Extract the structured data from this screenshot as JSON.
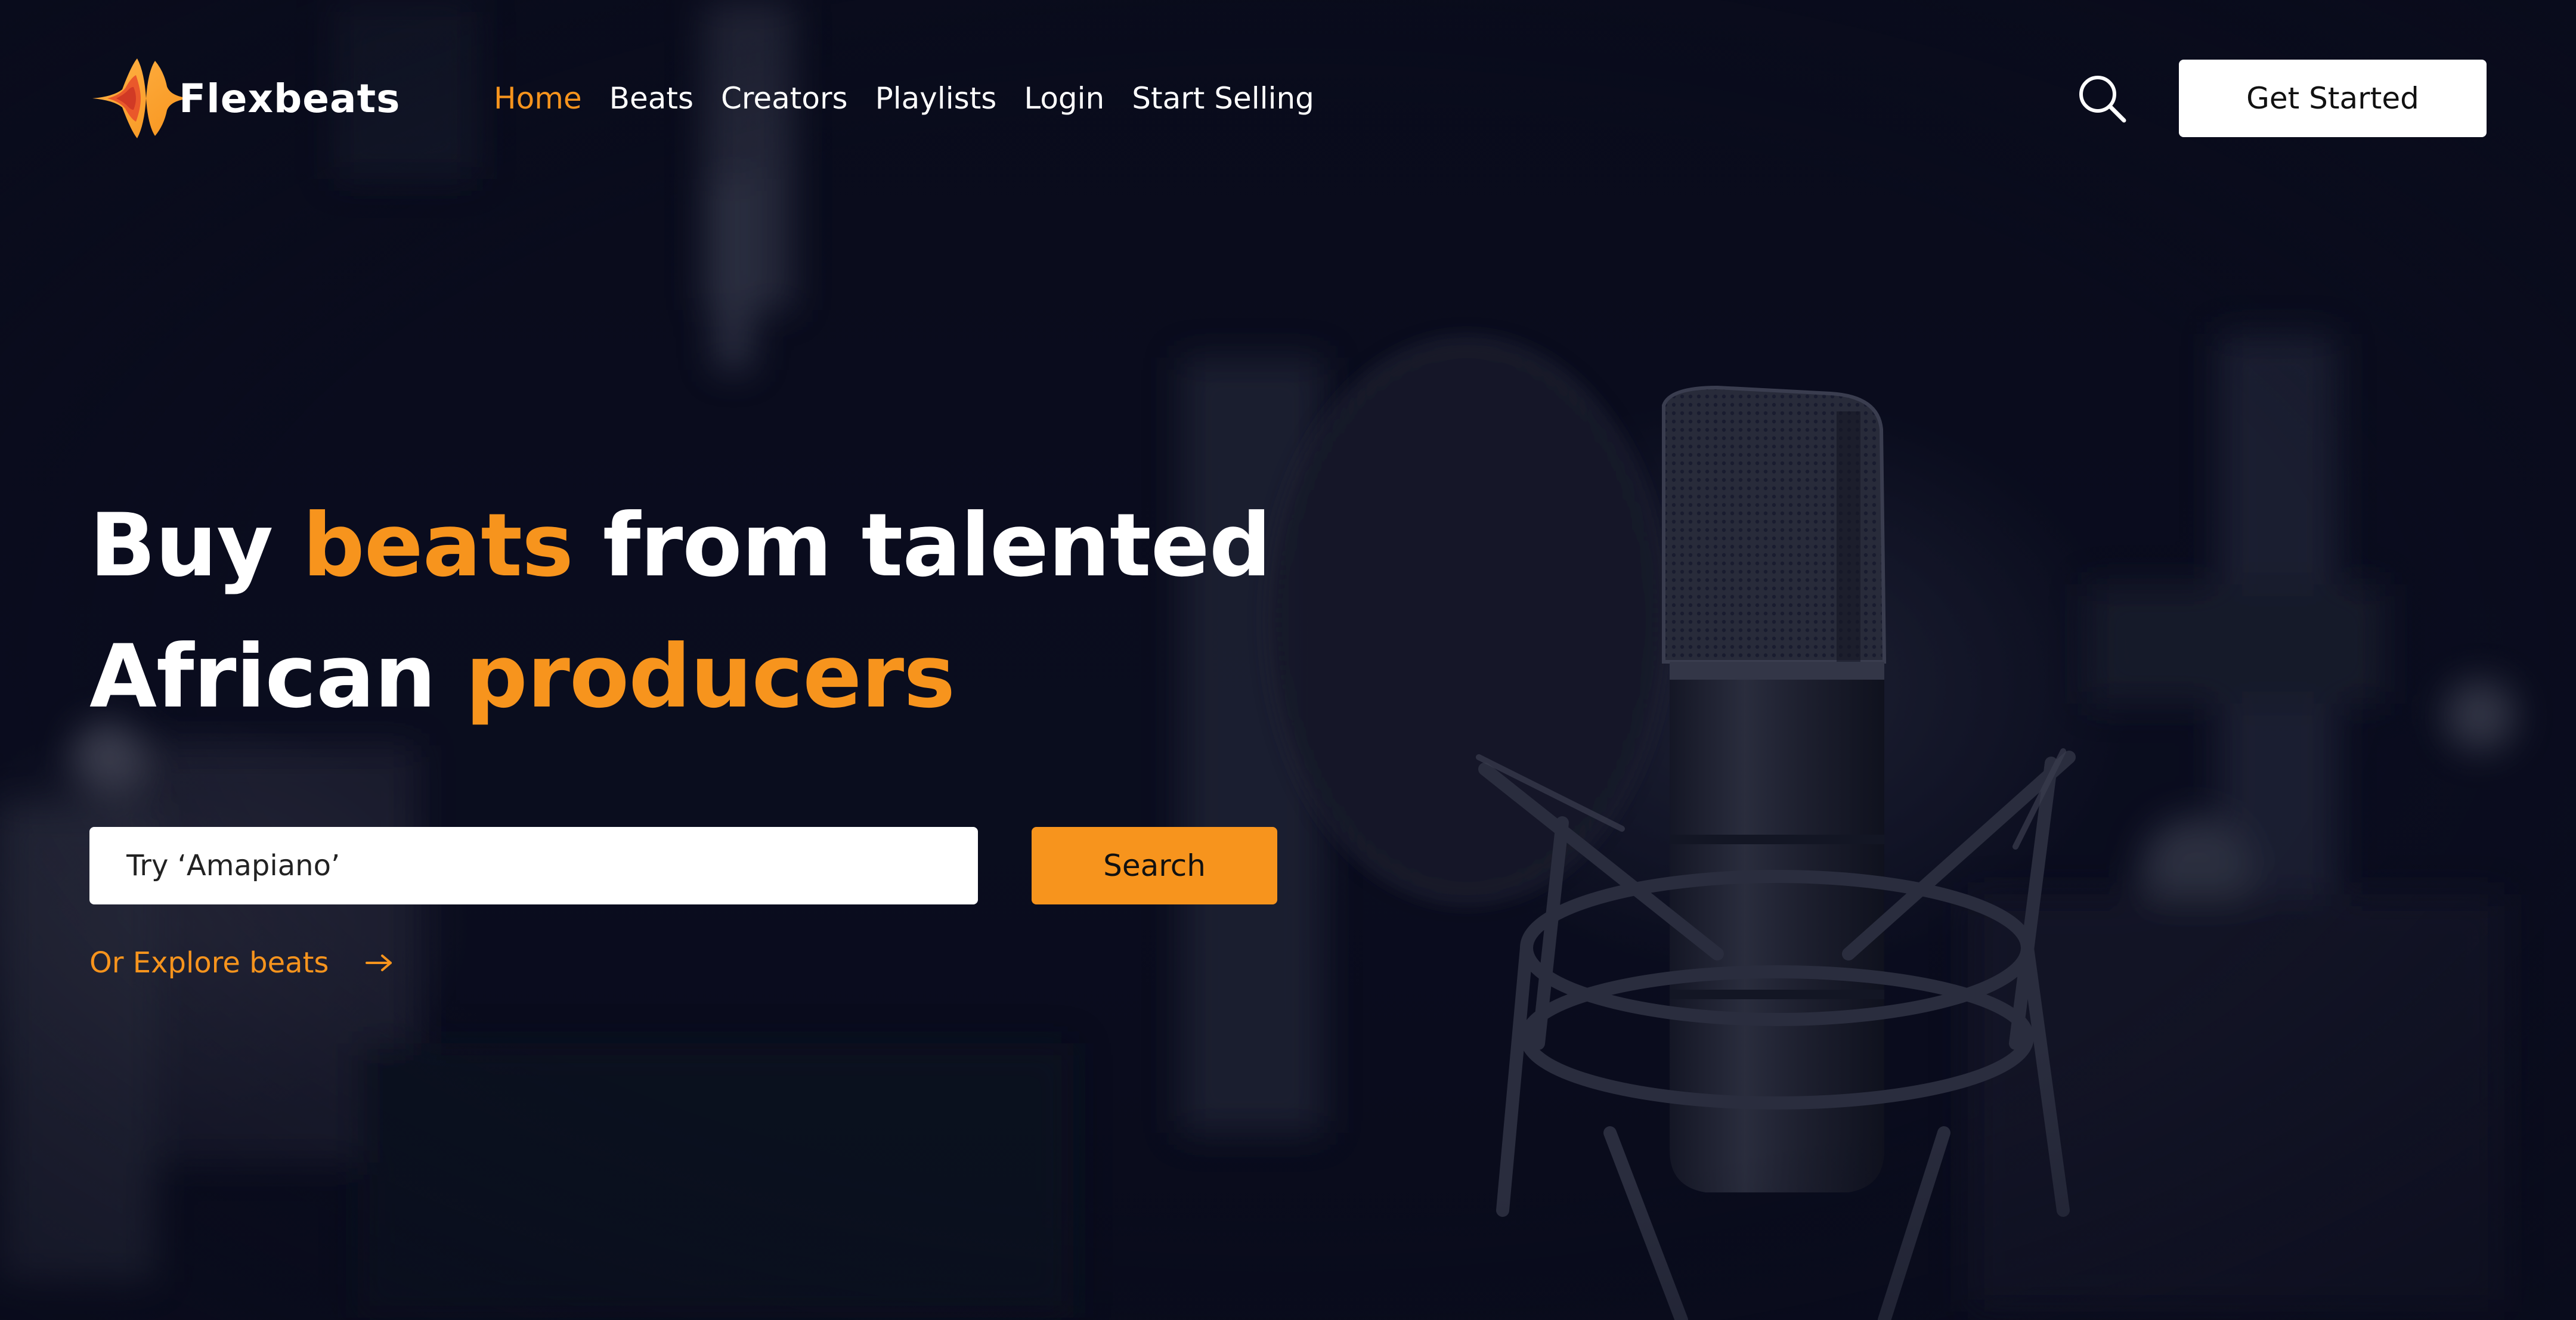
{
  "brand": {
    "name": "Flexbeats",
    "accent_color": "#f7941d",
    "background_color": "#0a0c1c"
  },
  "nav": {
    "items": [
      {
        "label": "Home",
        "active": true
      },
      {
        "label": "Beats",
        "active": false
      },
      {
        "label": "Creators",
        "active": false
      },
      {
        "label": "Playlists",
        "active": false
      },
      {
        "label": "Login",
        "active": false
      },
      {
        "label": "Start Selling",
        "active": false
      }
    ]
  },
  "header": {
    "search_icon": "search-icon",
    "cta_label": "Get Started"
  },
  "hero": {
    "headline": {
      "part1": "Buy ",
      "accent1": "beats",
      "part2": " from talented",
      "part3": "African ",
      "accent2": "producers"
    },
    "search": {
      "placeholder": "Try ‘Amapiano’",
      "value": "",
      "button_label": "Search"
    },
    "explore": {
      "label": "Or Explore beats",
      "icon": "arrow-right-icon"
    },
    "background_image": "studio-microphone-photo"
  }
}
